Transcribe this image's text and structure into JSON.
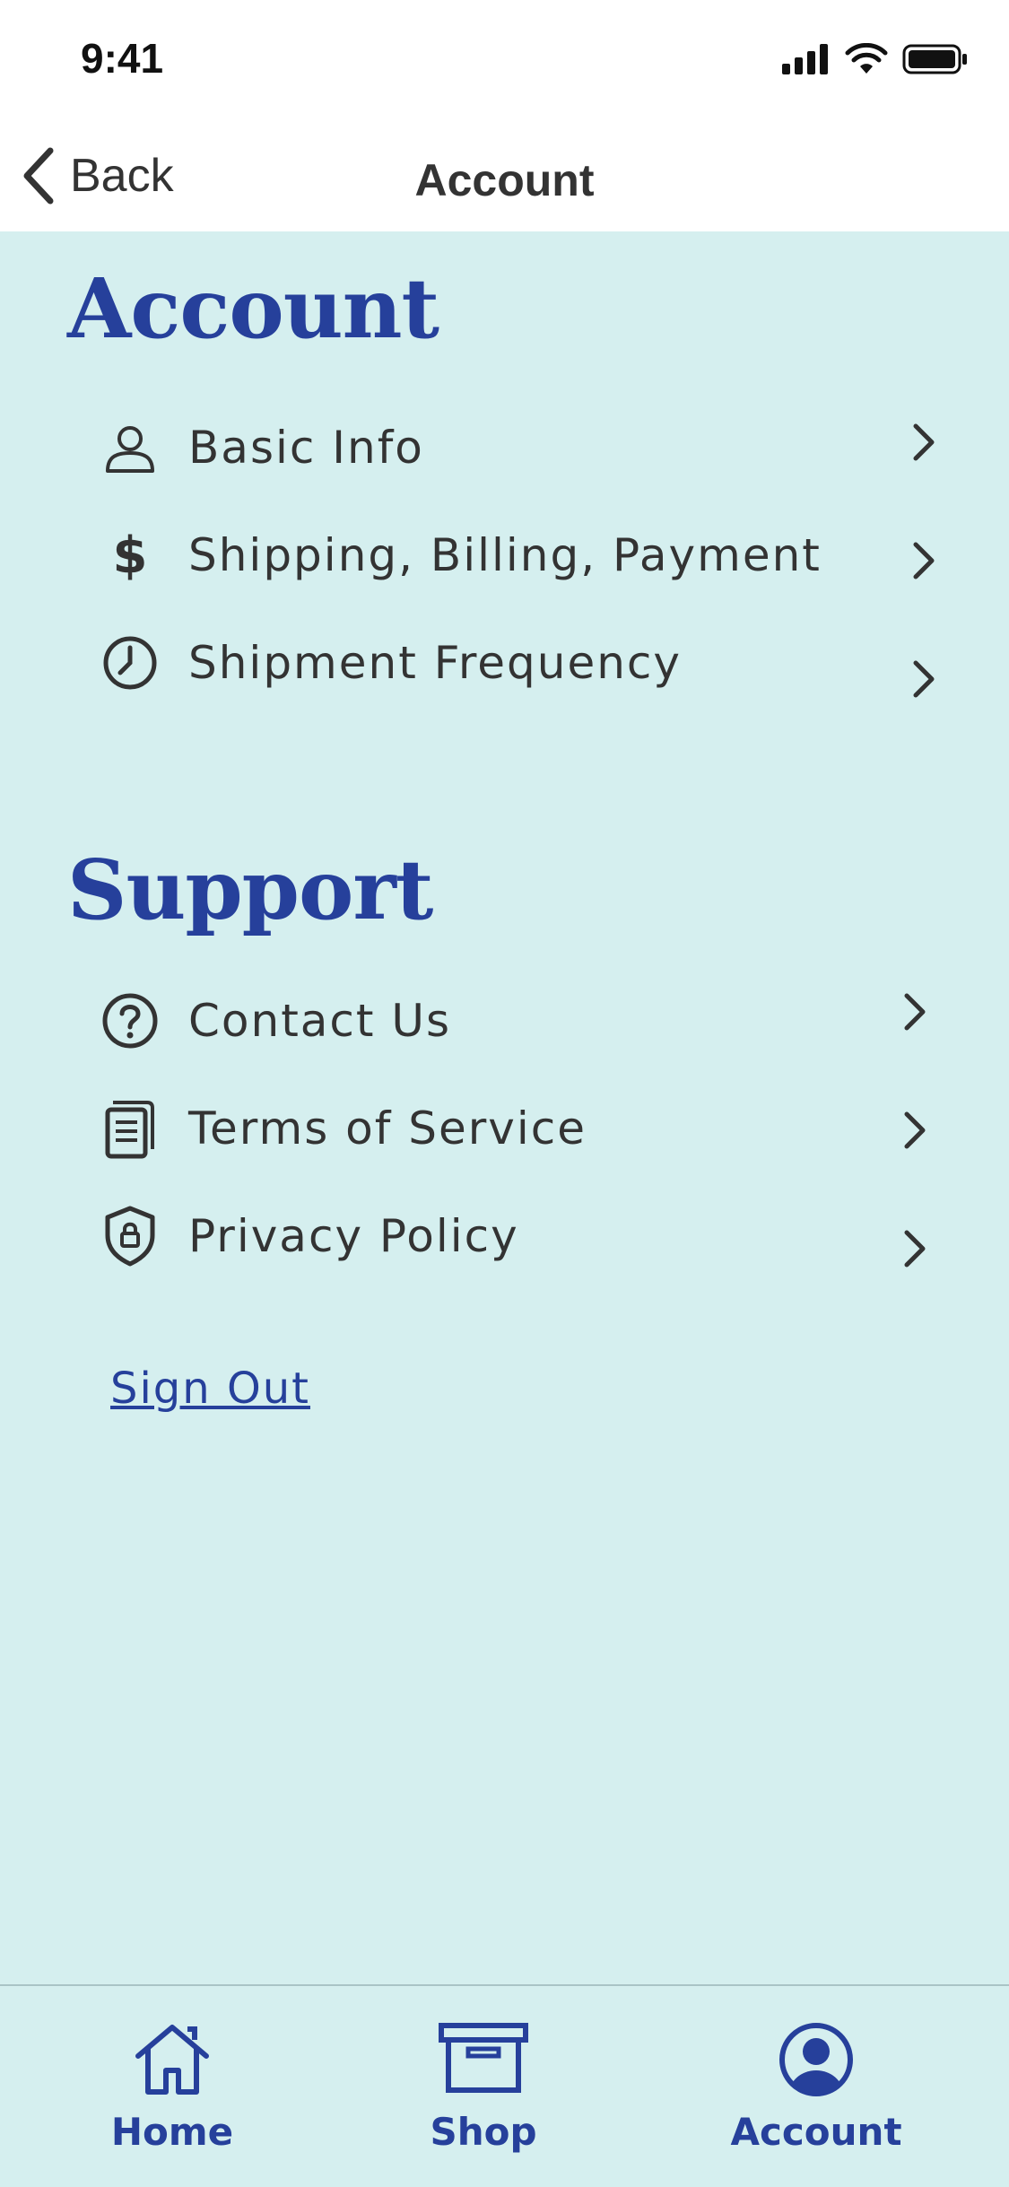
{
  "status_bar": {
    "time": "9:41"
  },
  "nav": {
    "back_label": "Back",
    "title": "Account"
  },
  "sections": {
    "account": {
      "title": "Account",
      "items": [
        {
          "label": "Basic Info",
          "icon": "person-icon"
        },
        {
          "label": "Shipping, Billing, Payment",
          "icon": "dollar-icon"
        },
        {
          "label": "Shipment Frequency",
          "icon": "clock-icon"
        }
      ]
    },
    "support": {
      "title": "Support",
      "items": [
        {
          "label": "Contact Us",
          "icon": "question-circle-icon"
        },
        {
          "label": "Terms of Service",
          "icon": "document-icon"
        },
        {
          "label": "Privacy Policy",
          "icon": "shield-lock-icon"
        }
      ]
    }
  },
  "sign_out_label": "Sign Out",
  "tabs": [
    {
      "label": "Home",
      "icon": "home-icon",
      "active": false
    },
    {
      "label": "Shop",
      "icon": "box-icon",
      "active": false
    },
    {
      "label": "Account",
      "icon": "account-circle-icon",
      "active": true
    }
  ],
  "colors": {
    "background": "#d5efef",
    "accent": "#26409b",
    "text": "#333333"
  }
}
